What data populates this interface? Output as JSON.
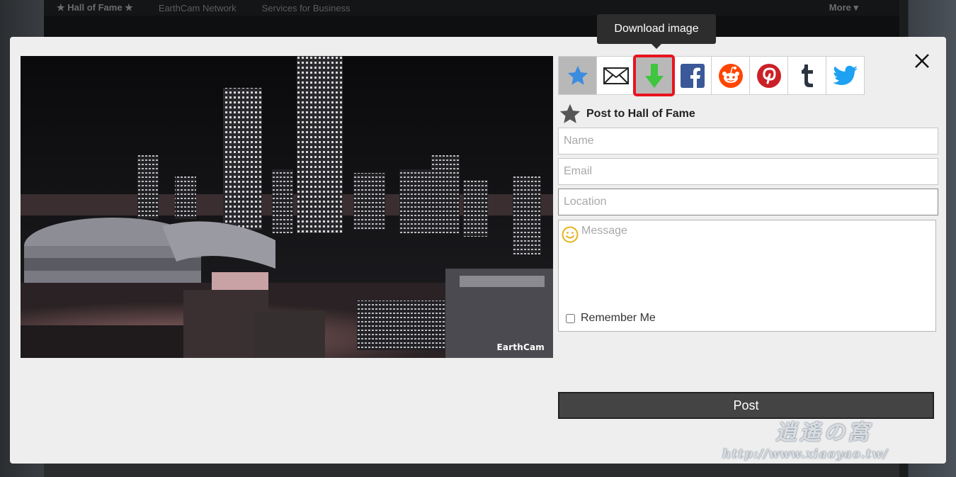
{
  "background": {
    "nav_items": [
      "★ Hall of Fame ★",
      "EarthCam Network",
      "Services for Business"
    ],
    "more_label": "More ▾"
  },
  "image": {
    "logo_text": "EarthCam"
  },
  "tooltip": {
    "text": "Download image"
  },
  "share_buttons": [
    {
      "name": "hall-of-fame-star-icon",
      "state": "active"
    },
    {
      "name": "email-envelope-icon",
      "state": "default"
    },
    {
      "name": "download-arrow-icon",
      "state": "highlighted"
    },
    {
      "name": "facebook-icon",
      "state": "default"
    },
    {
      "name": "reddit-icon",
      "state": "default"
    },
    {
      "name": "pinterest-icon",
      "state": "default"
    },
    {
      "name": "tumblr-icon",
      "state": "default"
    },
    {
      "name": "twitter-icon",
      "state": "default"
    }
  ],
  "form": {
    "heading": "Post to Hall of Fame",
    "name_placeholder": "Name",
    "email_placeholder": "Email",
    "location_placeholder": "Location",
    "message_placeholder": "Message",
    "remember_label": "Remember Me",
    "post_label": "Post"
  },
  "watermark": {
    "cjk": "逍遙の窩",
    "url": "http://www.xiaoyao.tw/"
  },
  "colors": {
    "highlight_red": "#e8141f",
    "download_green": "#3fc53f",
    "facebook": "#3b5998",
    "reddit": "#ff4500",
    "pinterest": "#cb2027",
    "twitter": "#1da1f2",
    "star_blue": "#3c8de0"
  }
}
